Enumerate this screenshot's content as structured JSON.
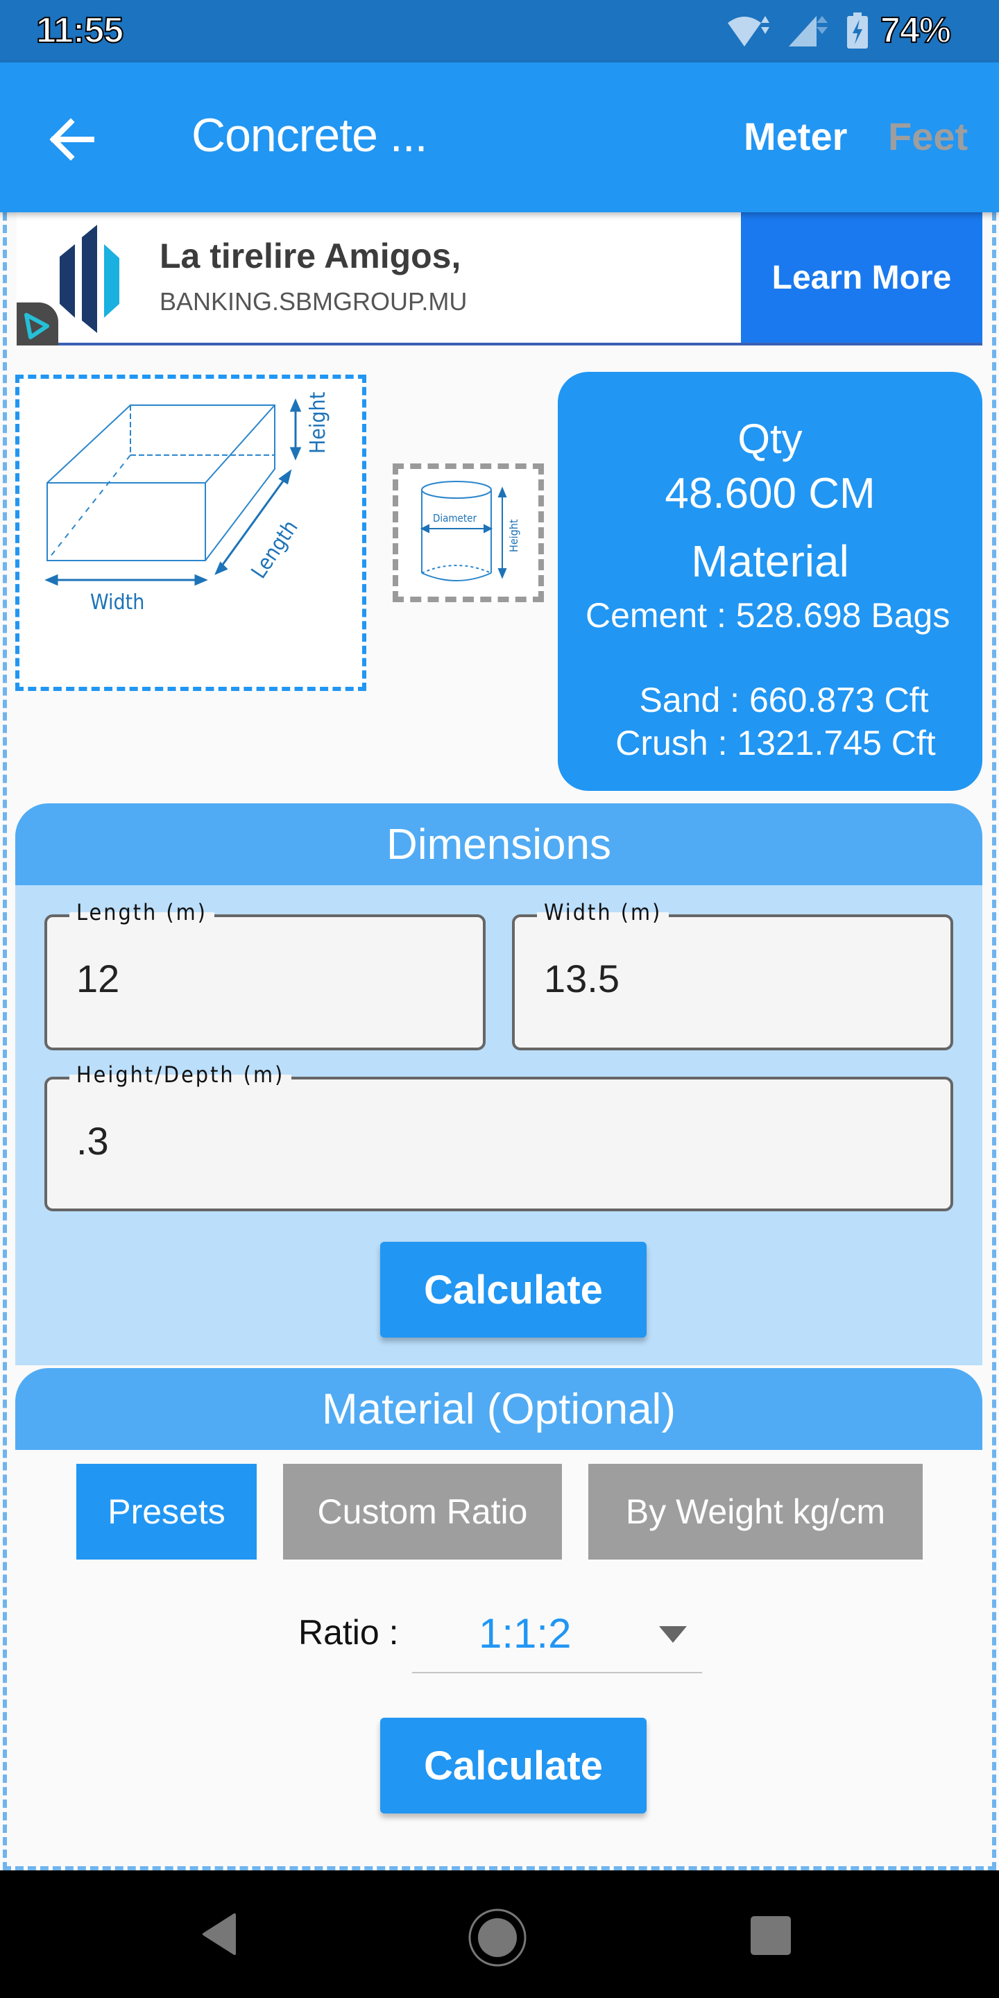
{
  "status_bar": {
    "time": "11:55",
    "battery_percent": "74%",
    "icons": [
      "wifi-icon",
      "cell-signal-icon",
      "battery-charging-icon"
    ]
  },
  "app_bar": {
    "title": "Concrete ...",
    "back_icon": "arrow-back-icon",
    "unit_options": [
      {
        "label": "Meter",
        "selected": true
      },
      {
        "label": "Feet",
        "selected": false
      }
    ]
  },
  "ad": {
    "title": "La tirelire Amigos,",
    "url": "BANKING.SBMGROUP.MU",
    "cta_label": "Learn More",
    "brand_colors": [
      "#1b3a6b",
      "#1ab0e0"
    ]
  },
  "diagrams": {
    "rectangular": {
      "labels": [
        "Width",
        "Length",
        "Height"
      ],
      "selected": true
    },
    "cylindrical": {
      "labels": [
        "Diameter",
        "Height"
      ],
      "selected": false
    }
  },
  "results": {
    "qty_label": "Qty",
    "qty_value": "48.600 CM",
    "material_label": "Material",
    "cement": "Cement : 528.698 Bags",
    "sand": "Sand : 660.873 Cft",
    "crush": "Crush : 1321.745 Cft"
  },
  "dimensions": {
    "title": "Dimensions",
    "fields": [
      {
        "label": "Length (m)",
        "value": "12"
      },
      {
        "label": "Width (m)",
        "value": "13.5"
      },
      {
        "label": "Height/Depth (m)",
        "value": ".3"
      }
    ],
    "calculate_label": "Calculate"
  },
  "material": {
    "title": "Material (Optional)",
    "tabs": [
      {
        "label": "Presets",
        "active": true
      },
      {
        "label": "Custom Ratio",
        "active": false
      },
      {
        "label": "By Weight kg/cm",
        "active": false
      }
    ],
    "ratio_label": "Ratio :",
    "ratio_value": "1:1:2",
    "calculate_label": "Calculate"
  },
  "colors": {
    "primary": "#2196f3",
    "section_header": "#50abf4",
    "section_body": "#bbdefa",
    "inactive_tab": "#9e9e9e",
    "status_bar": "#1c73bf"
  }
}
